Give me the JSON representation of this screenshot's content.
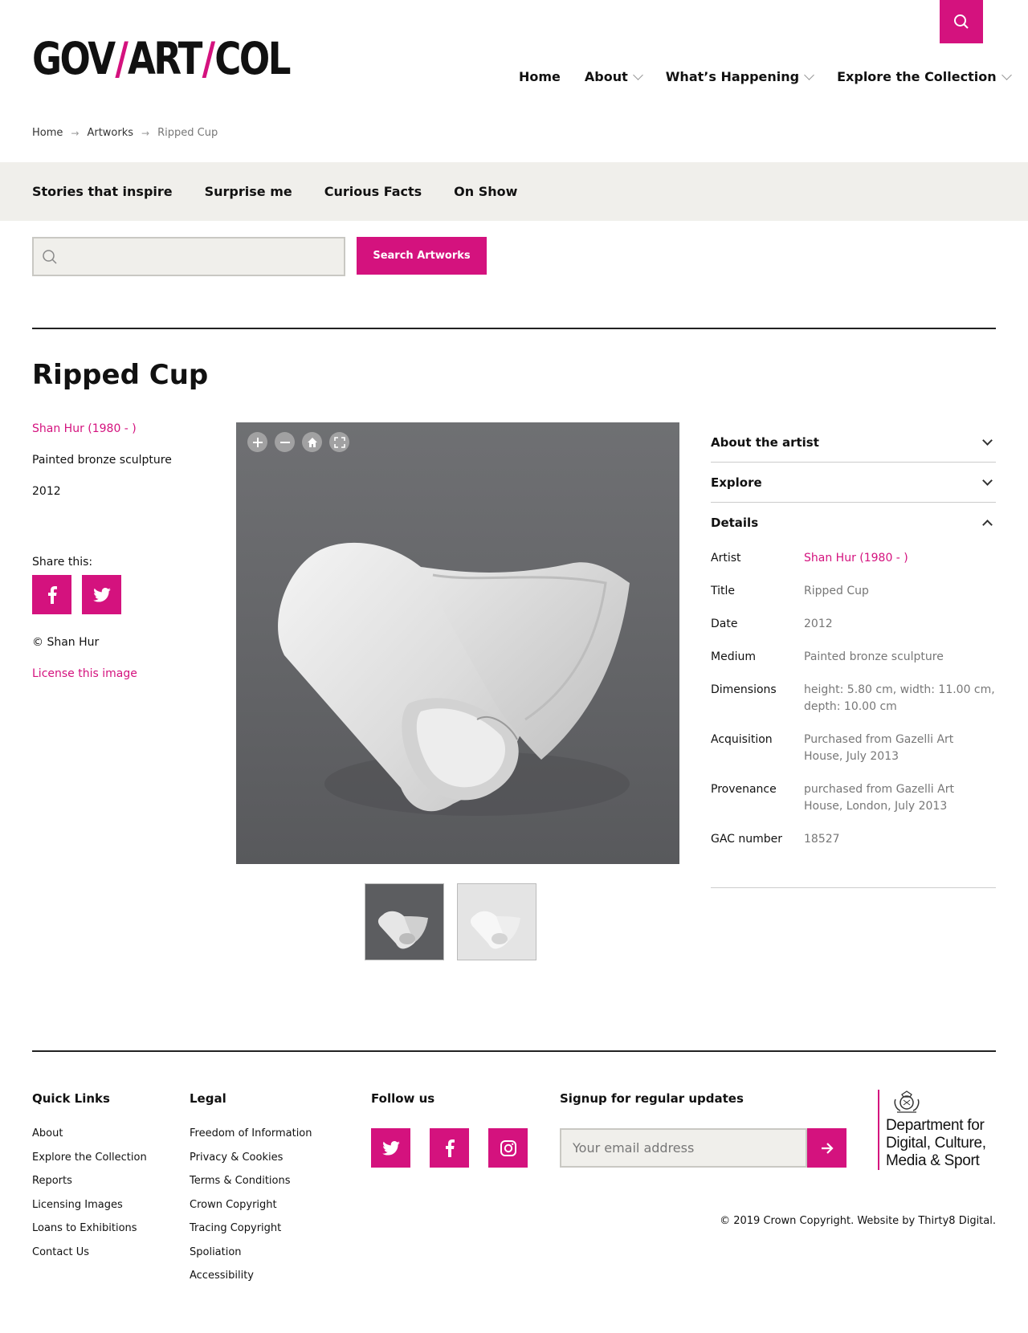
{
  "header": {
    "logo": {
      "part1": "GOV",
      "slash": "/",
      "part2": "ART",
      "part3": "COL"
    },
    "nav": [
      {
        "label": "Home",
        "has_dropdown": false
      },
      {
        "label": "About",
        "has_dropdown": true
      },
      {
        "label": "What’s Happening",
        "has_dropdown": true
      },
      {
        "label": "Explore the Collection",
        "has_dropdown": true
      }
    ]
  },
  "breadcrumb": {
    "home": "Home",
    "artworks": "Artworks",
    "current": "Ripped Cup"
  },
  "subnav": [
    "Stories that inspire",
    "Surprise me",
    "Curious Facts",
    "On Show"
  ],
  "search": {
    "placeholder": "",
    "button": "Search Artworks"
  },
  "artwork": {
    "title": "Ripped Cup",
    "artist": "Shan Hur (1980 - )",
    "medium": "Painted bronze sculpture",
    "date": "2012",
    "share_label": "Share this:",
    "copyright": "© Shan Hur",
    "license_link": "License this image"
  },
  "accordion": {
    "about_artist": "About the artist",
    "explore": "Explore",
    "details": "Details"
  },
  "details": [
    {
      "key": "Artist",
      "value": "Shan Hur (1980 - )",
      "link": true
    },
    {
      "key": "Title",
      "value": "Ripped Cup",
      "link": false
    },
    {
      "key": "Date",
      "value": "2012",
      "link": false
    },
    {
      "key": "Medium",
      "value": "Painted bronze sculpture",
      "link": false
    },
    {
      "key": "Dimensions",
      "value": "height: 5.80 cm, width: 11.00 cm, depth: 10.00 cm",
      "link": false
    },
    {
      "key": "Acquisition",
      "value": "Purchased from Gazelli Art House, July 2013",
      "link": false
    },
    {
      "key": "Provenance",
      "value": "purchased from Gazelli Art House, London, July 2013",
      "link": false
    },
    {
      "key": "GAC number",
      "value": "18527",
      "link": false
    }
  ],
  "footer": {
    "quick_links_title": "Quick Links",
    "quick_links": [
      "About",
      "Explore the Collection",
      "Reports",
      "Licensing Images",
      "Loans to Exhibitions",
      "Contact Us"
    ],
    "legal_title": "Legal",
    "legal": [
      "Freedom of Information",
      "Privacy & Cookies",
      "Terms & Conditions",
      "Crown Copyright",
      "Tracing Copyright",
      "Spoliation",
      "Accessibility"
    ],
    "follow_title": "Follow us",
    "signup_title": "Signup for regular updates",
    "email_placeholder": "Your email address",
    "dcms": [
      "Department for",
      "Digital, Culture,",
      "Media & Sport"
    ],
    "copyright": "© 2019 Crown Copyright. Website by Thirty8 Digital."
  },
  "colors": {
    "accent": "#d4127e",
    "panel_bg": "#f0efeb"
  }
}
